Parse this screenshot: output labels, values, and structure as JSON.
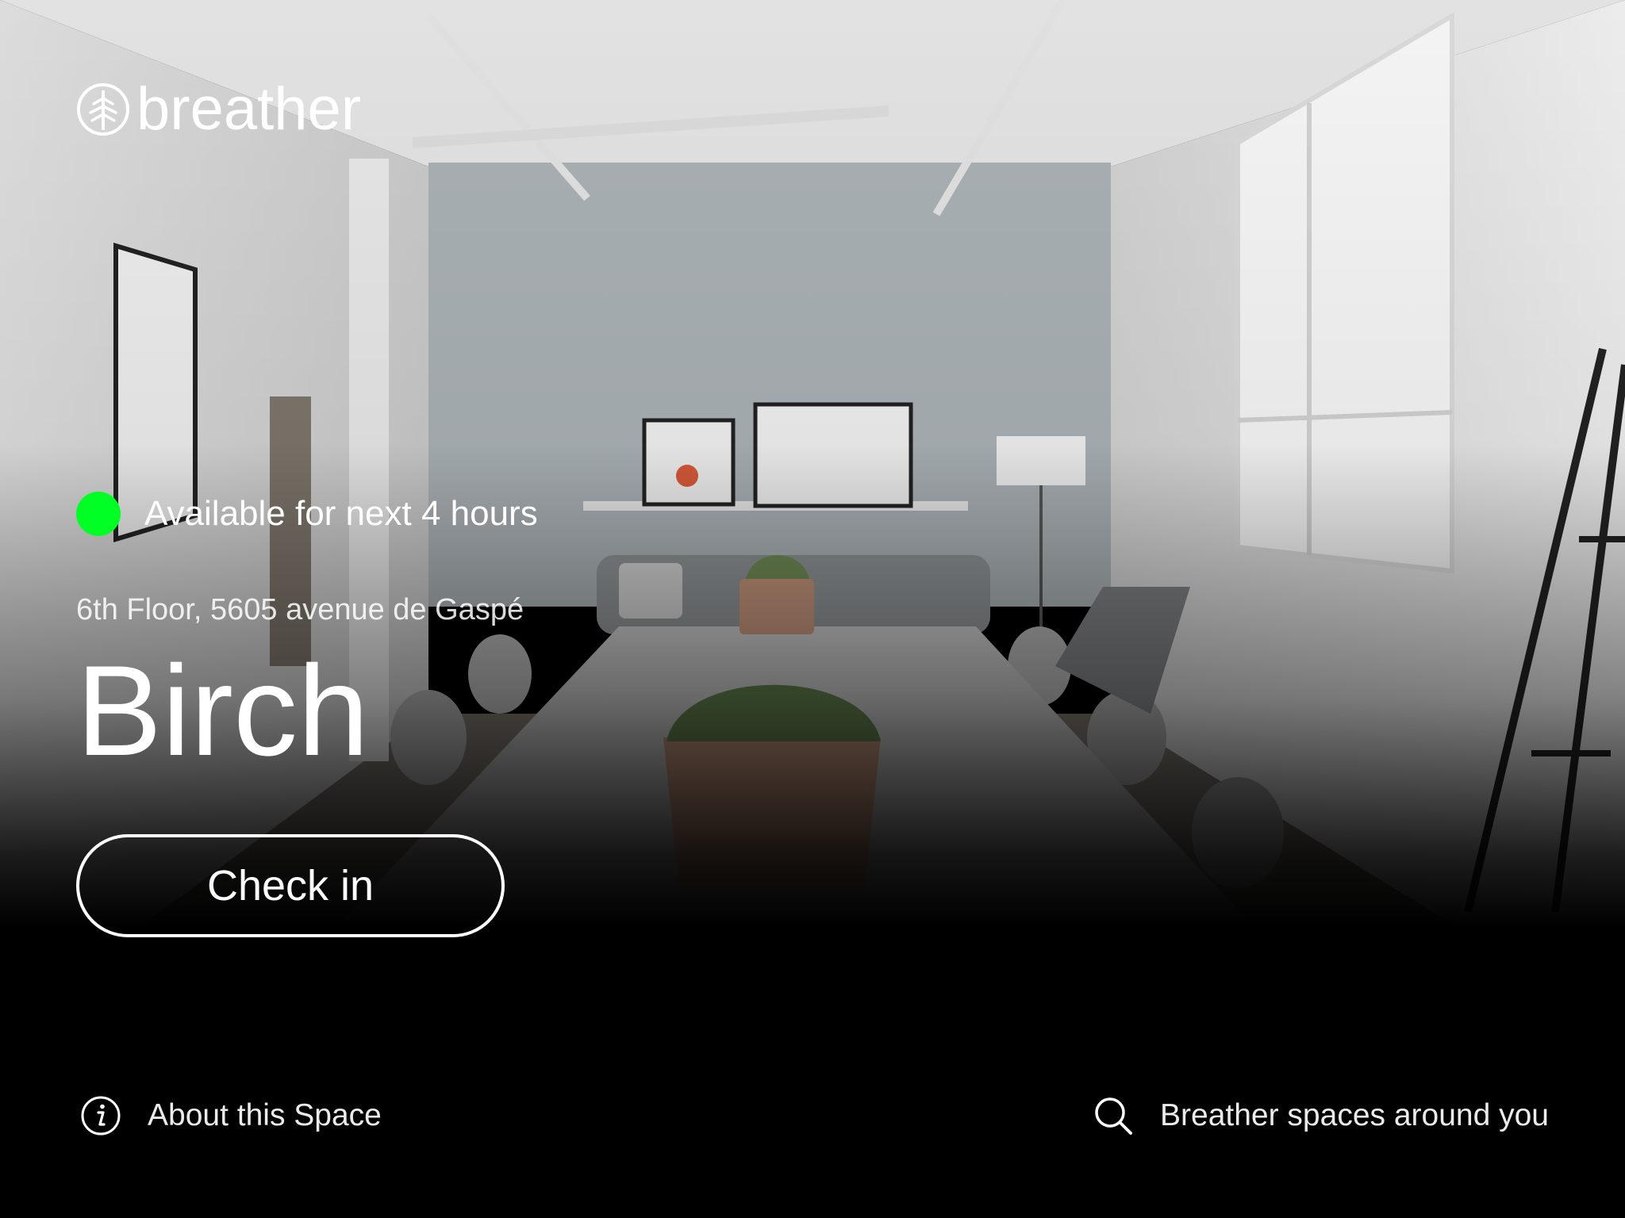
{
  "brand": {
    "name": "breather",
    "logo_icon": "tree-leaf-icon"
  },
  "availability": {
    "text": "Available for next 4 hours",
    "status_color": "#00ff24"
  },
  "space": {
    "address": "6th Floor, 5605 avenue de Gaspé",
    "name": "Birch"
  },
  "actions": {
    "checkin_label": "Check in"
  },
  "footer": {
    "about_label": "About this Space",
    "about_icon": "info-icon",
    "nearby_label": "Breather spaces around you",
    "nearby_icon": "search-icon"
  },
  "colors": {
    "text": "#ffffff",
    "background": "#000000",
    "available": "#00ff24"
  }
}
